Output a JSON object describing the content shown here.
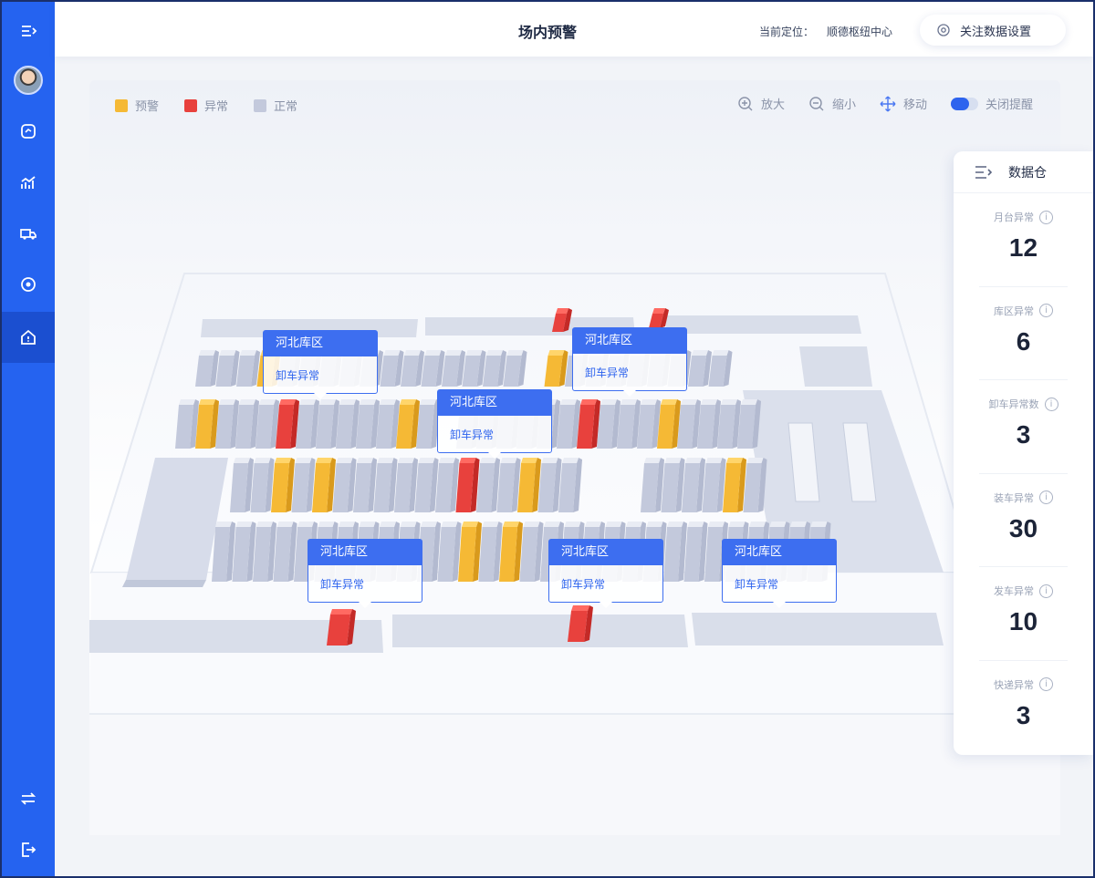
{
  "header": {
    "title": "场内预警",
    "location_label": "当前定位：",
    "location_value": "顺德枢纽中心",
    "settings_label": "关注数据设置"
  },
  "legend": [
    {
      "label": "预警",
      "color": "#f5b935"
    },
    {
      "label": "异常",
      "color": "#e8413d"
    },
    {
      "label": "正常",
      "color": "#c3c9dc"
    }
  ],
  "tools": {
    "zoom_in": "放大",
    "zoom_out": "缩小",
    "move": "移动",
    "close_alert": "关闭提醒"
  },
  "callouts": [
    {
      "zone": "河北库区",
      "text": "卸车异常"
    },
    {
      "zone": "河北库区",
      "text": "卸车异常"
    },
    {
      "zone": "河北库区",
      "text": "卸车异常"
    },
    {
      "zone": "河北库区",
      "text": "卸车异常"
    },
    {
      "zone": "河北库区",
      "text": "卸车异常"
    },
    {
      "zone": "河北库区",
      "text": "卸车异常"
    }
  ],
  "data_warehouse": {
    "title": "数据仓",
    "stats": [
      {
        "label": "月台异常",
        "value": "12"
      },
      {
        "label": "库区异常",
        "value": "6"
      },
      {
        "label": "卸车异常数",
        "value": "3"
      },
      {
        "label": "装车异常",
        "value": "30"
      },
      {
        "label": "发车异常",
        "value": "10"
      },
      {
        "label": "快递异常",
        "value": "3"
      }
    ]
  },
  "sidebar": {
    "icons": [
      "menu-icon",
      "avatar",
      "box-icon",
      "chart-icon",
      "truck-icon",
      "target-icon",
      "home-alert-icon",
      "switch-icon",
      "logout-icon"
    ]
  },
  "colors": {
    "primary": "#2563f0",
    "warning": "#f5b935",
    "abnormal": "#e8413d",
    "normal": "#c3c9dc"
  }
}
